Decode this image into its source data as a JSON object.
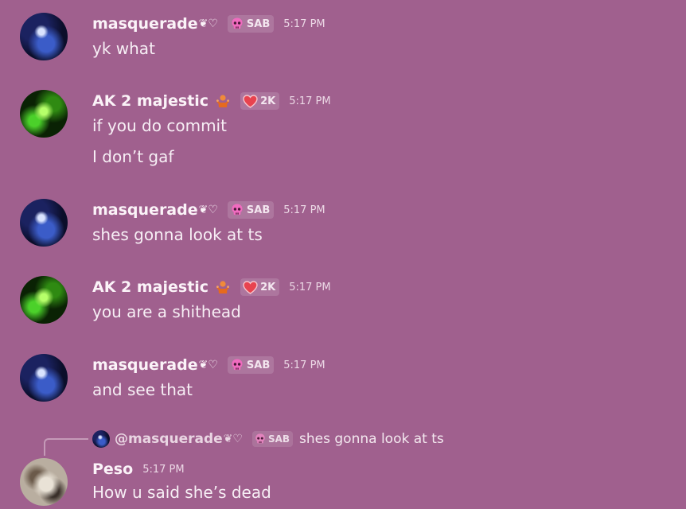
{
  "colors": {
    "background": "#a0608e",
    "text": "#f7eff5",
    "timestamp": "#ecd9e6",
    "skull_pink": "#f06bbf",
    "heart_red": "#e8434f"
  },
  "messages": [
    {
      "username": "masquerade",
      "deco": "❦♡",
      "tag_icon": "skull-icon",
      "tag": "SAB",
      "time": "5:17 PM",
      "lines": [
        "yk what"
      ]
    },
    {
      "username": "AK 2 majestic",
      "role_icon": "hugging-figure-icon",
      "tag_icon": "heart-icon",
      "tag": "2K",
      "time": "5:17 PM",
      "lines": [
        "if you do commit",
        "I don’t gaf"
      ]
    },
    {
      "username": "masquerade",
      "deco": "❦♡",
      "tag_icon": "skull-icon",
      "tag": "SAB",
      "time": "5:17 PM",
      "lines": [
        "shes gonna look at ts"
      ]
    },
    {
      "username": "AK 2 majestic",
      "role_icon": "hugging-figure-icon",
      "tag_icon": "heart-icon",
      "tag": "2K",
      "time": "5:17 PM",
      "lines": [
        "you are a shithead"
      ]
    },
    {
      "username": "masquerade",
      "deco": "❦♡",
      "tag_icon": "skull-icon",
      "tag": "SAB",
      "time": "5:17 PM",
      "lines": [
        "and see that"
      ]
    },
    {
      "reply": {
        "username": "@masquerade",
        "deco": "❦♡",
        "tag_icon": "skull-icon",
        "tag": "SAB",
        "text": "shes gonna look at ts"
      },
      "username": "Peso",
      "time": "5:17 PM",
      "lines": [
        "How u said she’s dead"
      ]
    }
  ]
}
